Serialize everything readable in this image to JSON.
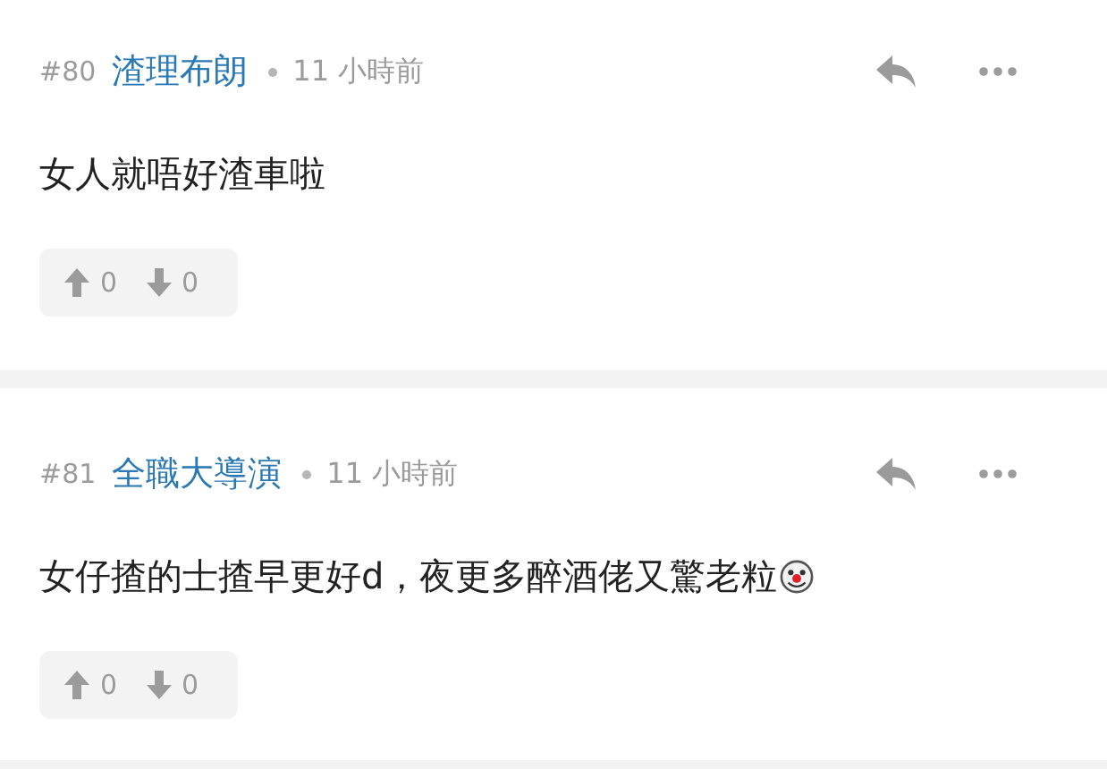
{
  "comments": [
    {
      "number": "#80",
      "author": "渣理布朗",
      "time": "11 小時前",
      "body": "女人就唔好渣車啦",
      "emoji": false,
      "upvotes": "0",
      "downvotes": "0"
    },
    {
      "number": "#81",
      "author": "全職大導演",
      "time": "11 小時前",
      "body": "女仔揸的士揸早更好d，夜更多醉酒佬又驚老粒",
      "emoji": true,
      "upvotes": "0",
      "downvotes": "0"
    }
  ]
}
